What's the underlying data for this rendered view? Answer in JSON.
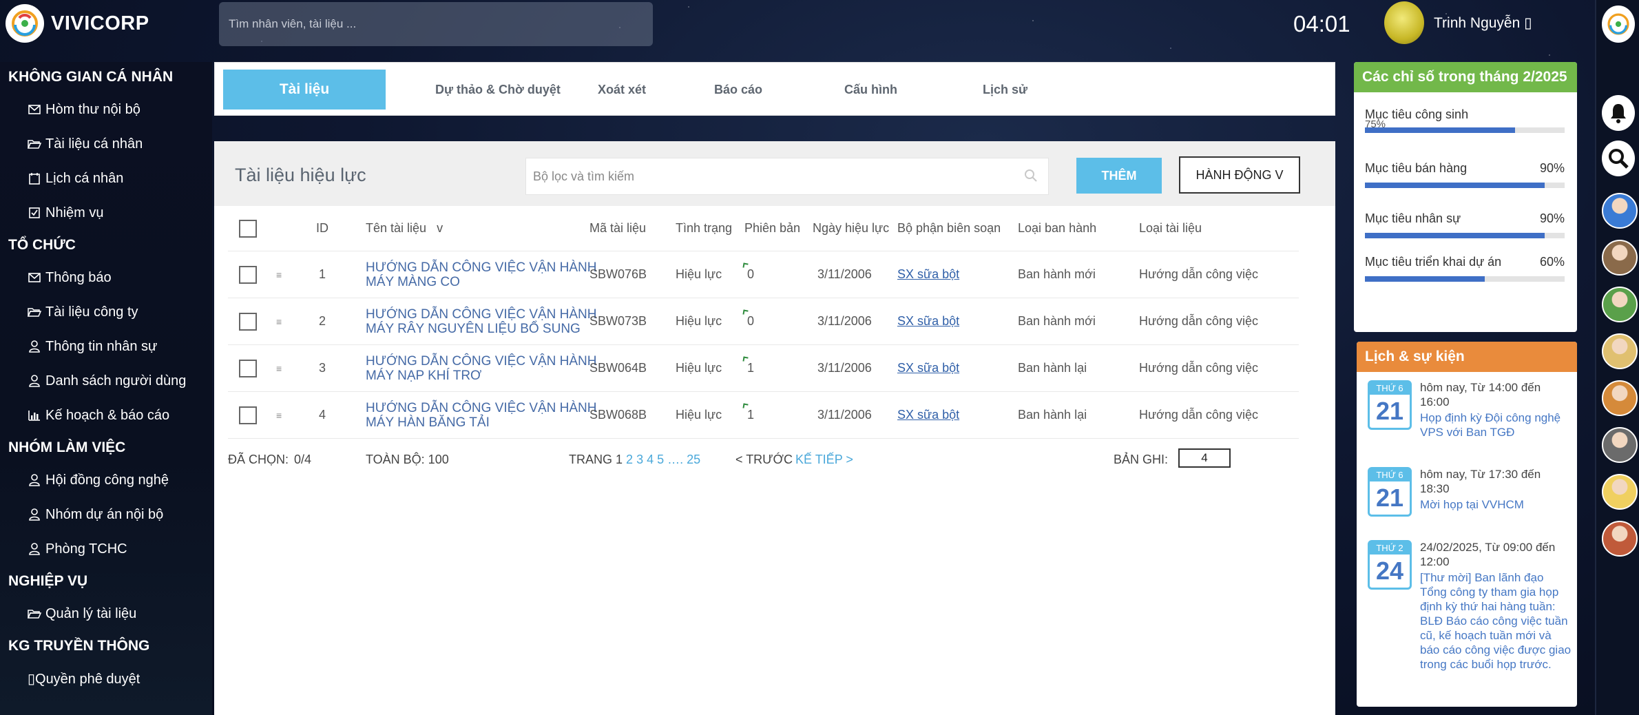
{
  "app": {
    "name": "VIVICORP"
  },
  "search": {
    "placeholder": "Tìm nhân viên, tài liệu ..."
  },
  "clock": "04:01",
  "user": {
    "name": "Trinh Nguyễn ▯"
  },
  "sidebar": {
    "sections": [
      {
        "title": "KHÔNG GIAN CÁ NHÂN",
        "items": [
          {
            "label": "Hòm thư nội bộ",
            "icon": "envelope-icon"
          },
          {
            "label": "Tài liệu cá nhân",
            "icon": "folder-open-icon"
          },
          {
            "label": "Lịch cá nhân",
            "icon": "calendar-icon"
          },
          {
            "label": "Nhiệm vụ",
            "icon": "checkbox-icon"
          }
        ]
      },
      {
        "title": "TỔ CHỨC",
        "items": [
          {
            "label": "Thông báo",
            "icon": "envelope-icon"
          },
          {
            "label": "Tài liệu công ty",
            "icon": "folder-open-icon"
          },
          {
            "label": "Thông tin nhân sự",
            "icon": "user-icon"
          },
          {
            "label": "Danh sách người dùng",
            "icon": "user-icon"
          },
          {
            "label": "Kế hoạch & báo cáo",
            "icon": "bar-chart-icon"
          }
        ]
      },
      {
        "title": "NHÓM LÀM VIỆC",
        "items": [
          {
            "label": "Hội đồng công nghệ",
            "icon": "user-icon"
          },
          {
            "label": "Nhóm dự án nội bộ",
            "icon": "user-icon"
          },
          {
            "label": "Phòng TCHC",
            "icon": "user-icon"
          }
        ]
      },
      {
        "title": "NGHIỆP VỤ",
        "items": [
          {
            "label": "Quản lý tài liệu",
            "icon": "folder-open-icon"
          }
        ]
      },
      {
        "title": "KG TRUYỀN THÔNG",
        "items": [
          {
            "label": "▯Quyền phê duyệt",
            "icon": ""
          }
        ]
      }
    ]
  },
  "tabs": [
    "Tài liệu",
    "Dự thảo & Chờ duyệt",
    "Xoát xét",
    "Báo cáo",
    "Cấu hình",
    "Lịch sử"
  ],
  "panel": {
    "title": "Tài liệu hiệu lực",
    "filter_placeholder": "Bộ lọc và tìm kiếm",
    "add_label": "THÊM",
    "action_label": "HÀNH ĐỘNG V"
  },
  "table": {
    "headers": {
      "id": "ID",
      "name": "Tên tài liệu",
      "sort": "v",
      "code": "Mã tài liệu",
      "status": "Tình trạng",
      "version": "Phiên bản",
      "date": "Ngày hiệu lực",
      "dept": "Bộ phận biên soạn",
      "issue_type": "Loại ban hành",
      "doc_type": "Loại tài liệu"
    },
    "rows": [
      {
        "id": "1",
        "name1": "HƯỚNG DẪN CÔNG VIỆC VẬN HÀNH",
        "name2": "MÁY MÀNG CO",
        "code": "SBW076B",
        "status": "Hiệu lực",
        "version": "0",
        "date": "3/11/2006",
        "dept": "SX sữa bột",
        "issue_type": "Ban hành mới",
        "doc_type": "Hướng dẫn công việc"
      },
      {
        "id": "2",
        "name1": "HƯỚNG DẪN CÔNG VIỆC VẬN HÀNH",
        "name2": "MÁY RÂY NGUYÊN LIỆU BỔ SUNG",
        "code": "SBW073B",
        "status": "Hiệu lực",
        "version": "0",
        "date": "3/11/2006",
        "dept": "SX sữa bột",
        "issue_type": "Ban hành mới",
        "doc_type": "Hướng dẫn công việc"
      },
      {
        "id": "3",
        "name1": "HƯỚNG DẪN CÔNG VIỆC VẬN HÀNH",
        "name2": "MÁY NẠP KHÍ TRƠ",
        "code": "SBW064B",
        "status": "Hiệu lực",
        "version": "1",
        "date": "3/11/2006",
        "dept": "SX sữa bột",
        "issue_type": "Ban hành lại",
        "doc_type": "Hướng dẫn công việc"
      },
      {
        "id": "4",
        "name1": "HƯỚNG DẪN CÔNG VIỆC VẬN HÀNH",
        "name2": "MÁY HÀN BĂNG TẢI",
        "code": "SBW068B",
        "status": "Hiệu lực",
        "version": "1",
        "date": "3/11/2006",
        "dept": "SX sữa bột",
        "issue_type": "Ban hành lại",
        "doc_type": "Hướng dẫn công việc"
      }
    ]
  },
  "footer": {
    "selected_label": "ĐÃ CHỌN:",
    "selected_value": "0/4",
    "total": "TOÀN BỘ: 100",
    "page_label": "TRANG 1",
    "pages": [
      "2",
      "3",
      "4",
      "5",
      "…. 25"
    ],
    "prev": "< TRƯỚC",
    "next": "KẾ TIẾP >",
    "records_label": "BẢN GHI:",
    "records_value": "4"
  },
  "stats": {
    "title": "Các chỉ số trong tháng 2/2025",
    "items": [
      {
        "label": "Mục tiêu công sinh",
        "value_text": "75%",
        "fraction": 0.75
      },
      {
        "label": "Mục tiêu bán hàng",
        "value_text": "90%",
        "fraction": 0.9
      },
      {
        "label": "Mục tiêu nhân sự",
        "value_text": "90%",
        "fraction": 0.9
      },
      {
        "label": "Mục tiêu triển khai dự án",
        "value_text": "60%",
        "fraction": 0.6
      }
    ]
  },
  "events": {
    "title": "Lịch & sự kiện",
    "items": [
      {
        "weekday": "THỨ 6",
        "day": "21",
        "time": "hôm nay, Từ 14:00 đến 16:00",
        "title": "Họp định kỳ Đội công nghệ VPS với Ban TGĐ"
      },
      {
        "weekday": "THỨ 6",
        "day": "21",
        "time": "hôm nay, Từ 17:30 đến 18:30",
        "title": "Mời họp tại VVHCM"
      },
      {
        "weekday": "THỨ 2",
        "day": "24",
        "time": "24/02/2025, Từ 09:00 đến 12:00",
        "title": "[Thư mời] Ban lãnh đạo Tổng công ty tham gia họp định kỳ thứ hai hàng tuần: BLĐ Báo cáo công việc tuần cũ, kế hoạch tuần mới và báo cáo công việc được giao trong các buổi họp trước."
      }
    ]
  },
  "colors": {
    "accent": "#5cbee8",
    "stats_header": "#72b84a",
    "events_header": "#e98b3c",
    "bar_fill": "#3f6fc6",
    "link": "#456aa6"
  },
  "rail": {
    "avatars": 8
  }
}
